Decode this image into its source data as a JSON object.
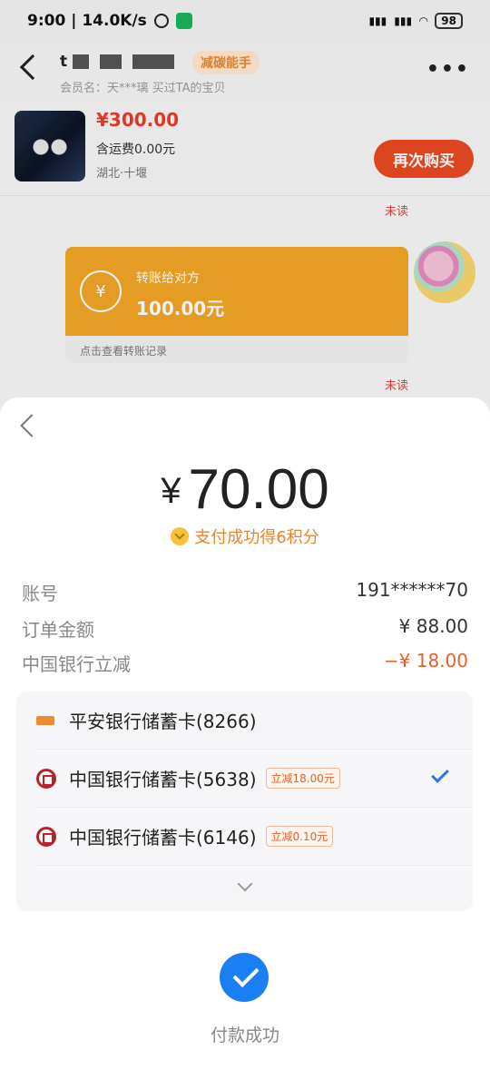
{
  "status_bar": {
    "time_speed": "9:00 | 14.0K/s",
    "battery": "98"
  },
  "chat": {
    "seller_name_visible": "t",
    "badge": "减碳能手",
    "member_line": "会员名：天***璃   买过TA的宝贝",
    "product": {
      "price": "¥300.00",
      "shipping": "含运费0.00元",
      "location": "湖北·十堰",
      "rebuy_label": "再次购买"
    },
    "unread_label": "未读",
    "transfer": {
      "title": "转账给对方",
      "amount": "100.00元",
      "footer": "点击查看转账记录",
      "icon_glyph": "¥"
    }
  },
  "payment_sheet": {
    "amount_symbol": "¥",
    "amount": "70.00",
    "points_text": "支付成功得6积分",
    "rows": [
      {
        "label": "账号",
        "value": "191******70"
      },
      {
        "label": "订单金额",
        "value": "¥ 88.00"
      },
      {
        "label": "中国银行立减",
        "value": "−¥ 18.00"
      }
    ],
    "cards": [
      {
        "name": "平安银行储蓄卡(8266)",
        "tag": "",
        "selected": false
      },
      {
        "name": "中国银行储蓄卡(5638)",
        "tag": "立减18.00元",
        "selected": true
      },
      {
        "name": "中国银行储蓄卡(6146)",
        "tag": "立减0.10元",
        "selected": false
      }
    ],
    "success_text": "付款成功"
  },
  "colors": {
    "accent_orange": "#e8491f",
    "success_blue": "#1a7ff2",
    "discount": "#e5622c"
  }
}
